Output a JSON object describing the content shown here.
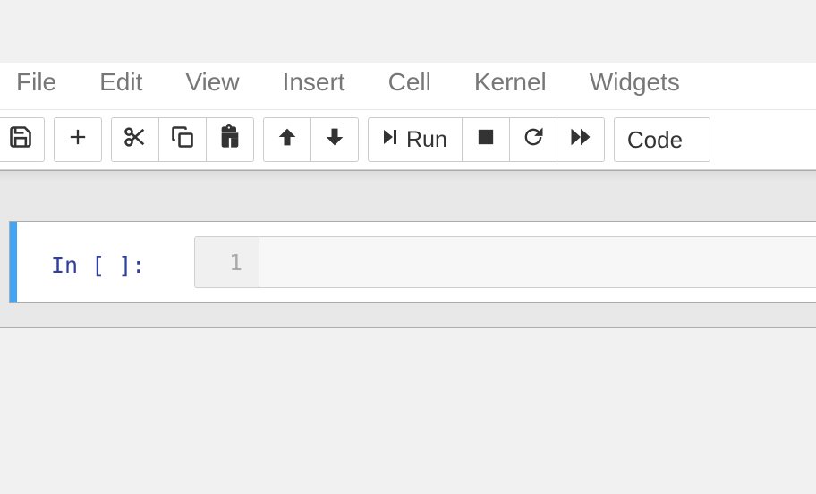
{
  "menu": {
    "items": [
      "File",
      "Edit",
      "View",
      "Insert",
      "Cell",
      "Kernel",
      "Widgets"
    ]
  },
  "toolbar": {
    "run_label": "Run",
    "cell_type": "Code"
  },
  "cell": {
    "prompt": "In [ ]:",
    "line_number": "1"
  }
}
